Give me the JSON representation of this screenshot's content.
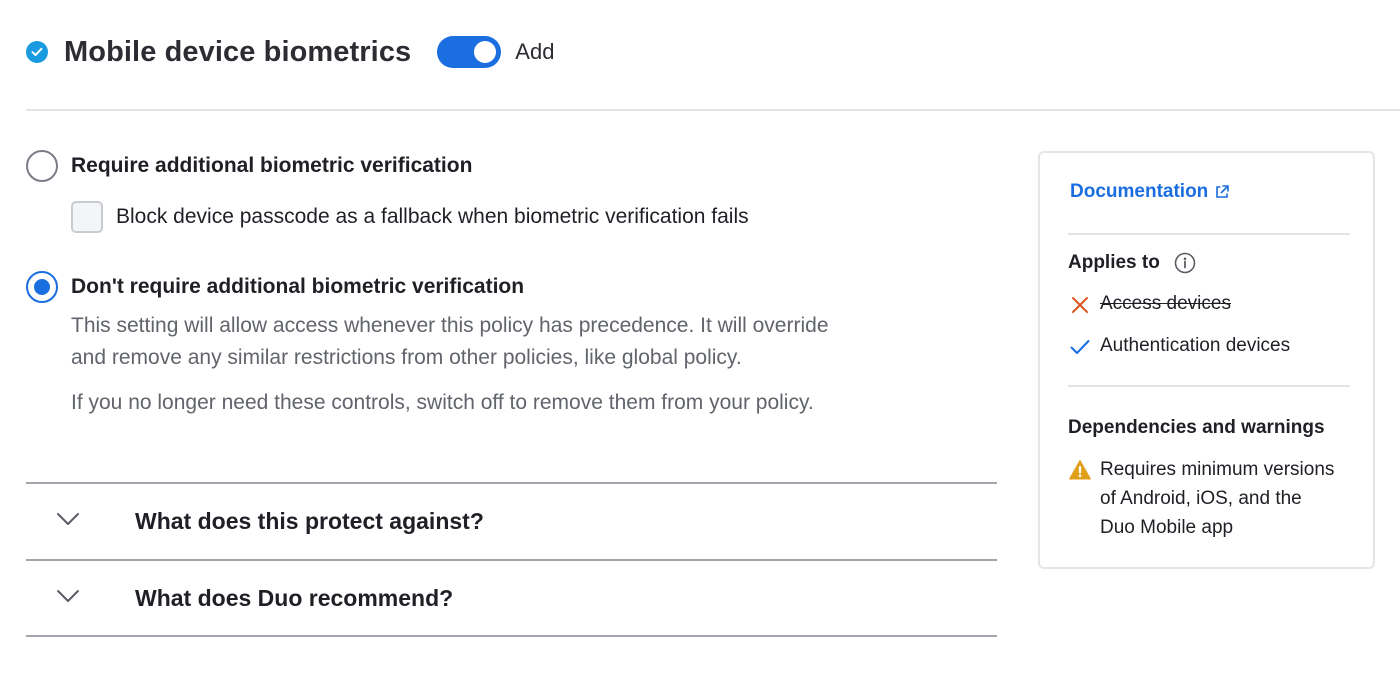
{
  "header": {
    "title": "Mobile device biometrics",
    "toggle_label": "Add",
    "toggle_on": true
  },
  "options": {
    "require": {
      "label": "Require additional biometric verification",
      "checked": false,
      "fallback_checkbox_label": "Block device passcode as a fallback when biometric verification fails"
    },
    "dont_require": {
      "label": "Don't require additional biometric verification",
      "checked": true,
      "description_line1": "This setting will allow access whenever this policy has precedence. It will override",
      "description_line2": "and remove any similar restrictions from other policies, like global policy.",
      "note": "If you no longer need these controls, switch off to remove them from your policy."
    }
  },
  "accordions": [
    {
      "label": "What does this protect against?"
    },
    {
      "label": "What does Duo recommend?"
    }
  ],
  "side_panel": {
    "documentation_link": "Documentation",
    "applies_to_heading": "Applies to",
    "applies_to": [
      {
        "label": "Access devices",
        "applies": false,
        "icon": "x-icon"
      },
      {
        "label": "Authentication devices",
        "applies": true,
        "icon": "check-icon"
      }
    ],
    "dependencies_heading": "Dependencies and warnings",
    "warning_line1": "Requires minimum versions",
    "warning_line2": "of Android, iOS, and the",
    "warning_line3": "Duo Mobile app"
  },
  "colors": {
    "accent": "#1a6ee0",
    "status_dot": "#1a9be0",
    "error": "#d9541e",
    "warning": "#e0a01a"
  }
}
